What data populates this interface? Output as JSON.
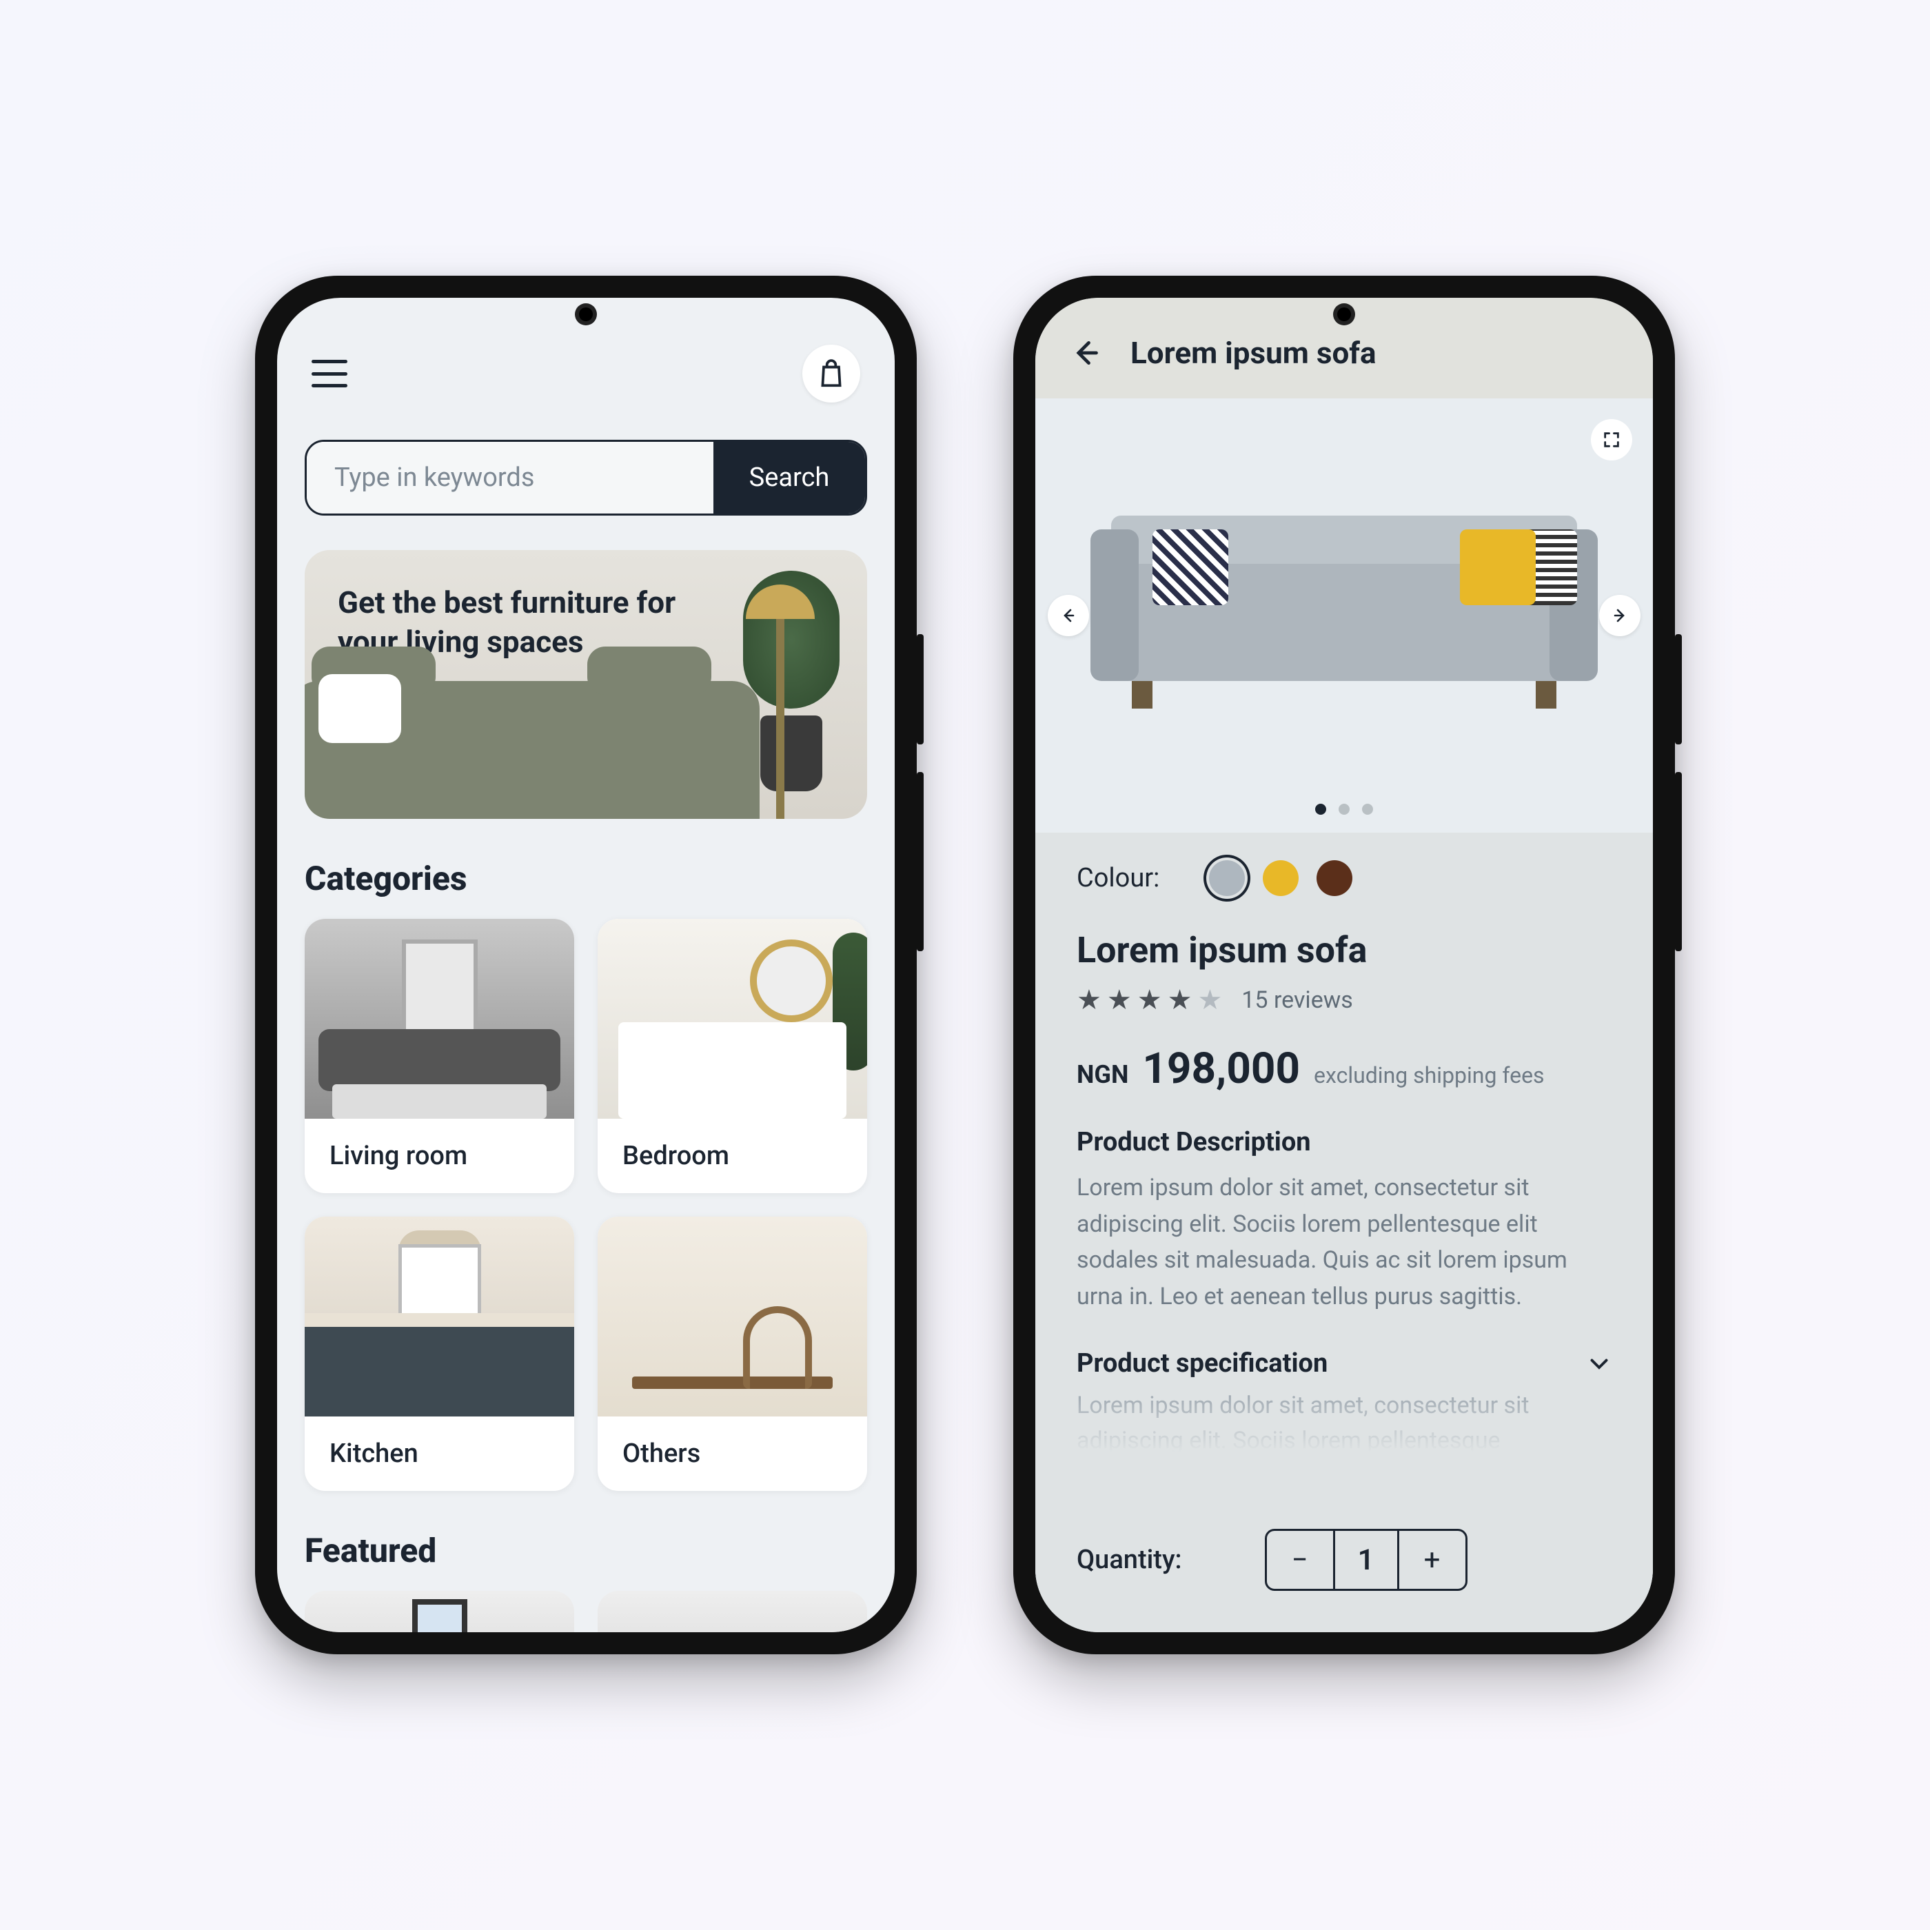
{
  "home": {
    "search": {
      "placeholder": "Type in keywords",
      "button": "Search"
    },
    "banner": {
      "headline": "Get the best furniture for your living spaces"
    },
    "categories": {
      "title": "Categories",
      "items": [
        "Living room",
        "Bedroom",
        "Kitchen",
        "Others"
      ]
    },
    "featured": {
      "title": "Featured"
    }
  },
  "product": {
    "header_title": "Lorem ipsum sofa",
    "colour_label": "Colour:",
    "colours": [
      "#aeb7bf",
      "#e8b828",
      "#5b2f1a"
    ],
    "selected_colour_index": 0,
    "gallery": {
      "count": 3,
      "active": 0
    },
    "name": "Lorem ipsum sofa",
    "rating": 4,
    "reviews_text": "15 reviews",
    "currency": "NGN",
    "price": "198,000",
    "shipping_note": "excluding shipping fees",
    "description_heading": "Product Description",
    "description": "Lorem ipsum dolor sit amet, consectetur sit adipiscing elit. Sociis lorem pellentesque elit sodales sit malesuada. Quis ac sit lorem ipsum urna in. Leo et aenean tellus purus sagittis.",
    "spec_heading": "Product specification",
    "spec_preview": "Lorem ipsum dolor sit amet, consectetur sit adipiscing elit. Sociis lorem pellentesque",
    "quantity_label": "Quantity:",
    "quantity": 1
  }
}
